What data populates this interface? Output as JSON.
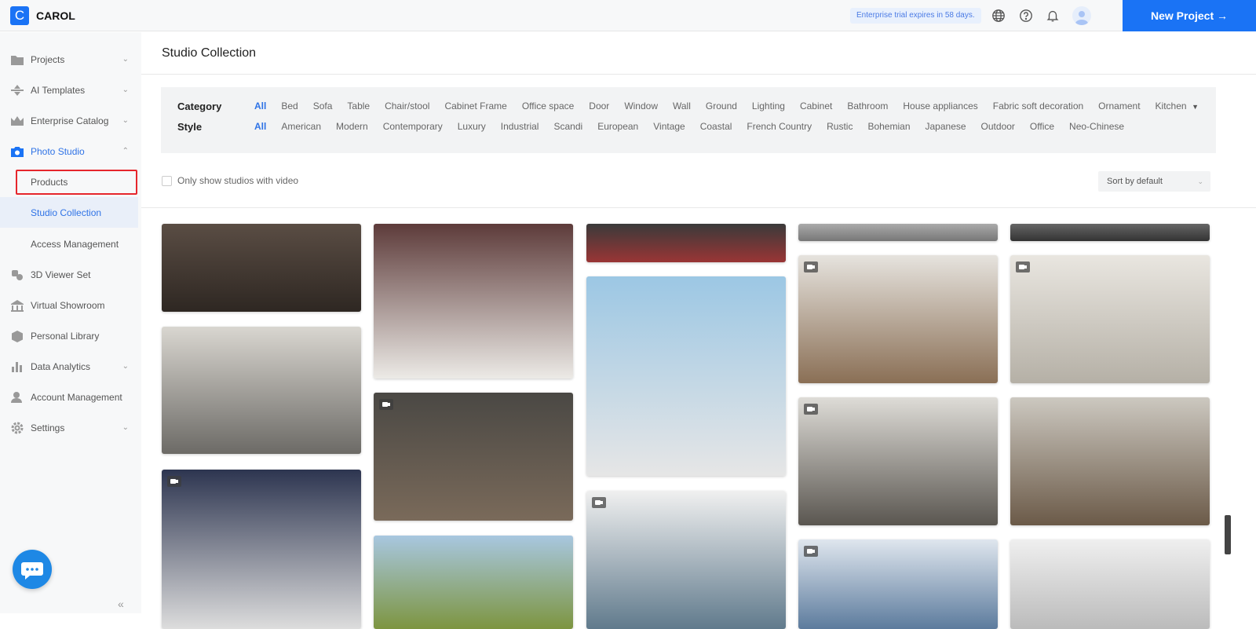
{
  "header": {
    "logo_letter": "C",
    "brand": "CAROL",
    "trial": "Enterprise trial expires in 58 days.",
    "new_project": "New Project →",
    "icons": [
      "globe-icon",
      "help-icon",
      "bell-icon",
      "avatar"
    ]
  },
  "sidebar": {
    "items": [
      {
        "label": "Projects",
        "icon": "folder-icon"
      },
      {
        "label": "AI Templates",
        "icon": "ai-icon"
      },
      {
        "label": "Enterprise Catalog",
        "icon": "crown-icon"
      },
      {
        "label": "Photo Studio",
        "icon": "camera-icon"
      },
      {
        "label": "Products"
      },
      {
        "label": "Studio Collection"
      },
      {
        "label": "Access Management"
      },
      {
        "label": "3D Viewer Set",
        "icon": "cube-icon"
      },
      {
        "label": "Virtual Showroom",
        "icon": "showroom-icon"
      },
      {
        "label": "Personal Library",
        "icon": "box-icon"
      },
      {
        "label": "Data Analytics",
        "icon": "chart-icon"
      },
      {
        "label": "Account Management",
        "icon": "user-icon"
      },
      {
        "label": "Settings",
        "icon": "gear-icon"
      }
    ],
    "collapse": "«"
  },
  "main": {
    "title": "Studio Collection",
    "category": {
      "label": "Category",
      "options": [
        "All",
        "Bed",
        "Sofa",
        "Table",
        "Chair/stool",
        "Cabinet Frame",
        "Office space",
        "Door",
        "Window",
        "Wall",
        "Ground",
        "Lighting",
        "Cabinet",
        "Bathroom",
        "House appliances",
        "Fabric soft decoration",
        "Ornament",
        "Kitchen"
      ],
      "selected": "All"
    },
    "style": {
      "label": "Style",
      "options": [
        "All",
        "American",
        "Modern",
        "Contemporary",
        "Luxury",
        "Industrial",
        "Scandi",
        "European",
        "Vintage",
        "Coastal",
        "French Country",
        "Rustic",
        "Bohemian",
        "Japanese",
        "Outdoor",
        "Office",
        "Neo-Chinese"
      ],
      "selected": "All"
    },
    "video_filter": "Only show studios with video",
    "sort": "Sort by default"
  },
  "colors": {
    "accent": "#1a73f5",
    "highlight_box": "#e6262c"
  }
}
